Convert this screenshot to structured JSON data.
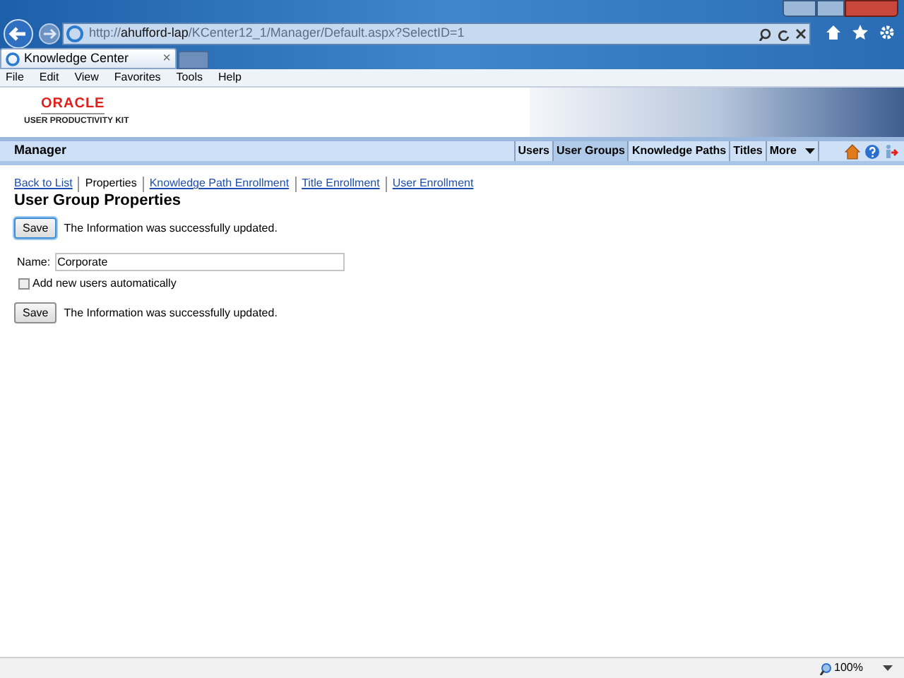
{
  "browser": {
    "url": "http://**ahufford-lap**/KCenter12_1/Manager/Default.aspx?SelectID=1",
    "tab": {
      "title": "Knowledge Center",
      "close": "×"
    },
    "menu": [
      "File",
      "Edit",
      "View",
      "Favorites",
      "Tools",
      "Help"
    ],
    "zoom": "100%"
  },
  "header": {
    "brand": "ORACLE",
    "product": "USER PRODUCTIVITY KIT"
  },
  "nav": {
    "title": "Manager",
    "items": [
      {
        "label": "Users",
        "selected": false
      },
      {
        "label": "User Groups",
        "selected": true
      },
      {
        "label": "Knowledge Paths",
        "selected": false
      },
      {
        "label": "Titles",
        "selected": false
      },
      {
        "label": "More",
        "selected": false
      }
    ]
  },
  "subnav": [
    {
      "label": "Back to List",
      "selected": false
    },
    {
      "label": "Properties",
      "selected": true
    },
    {
      "label": "Knowledge Path Enrollment",
      "selected": false
    },
    {
      "label": "Title Enrollment",
      "selected": false
    },
    {
      "label": "User Enrollment",
      "selected": false
    }
  ],
  "heading": "User Group Properties",
  "save_top": {
    "button": "Save",
    "focused": true,
    "message": "The Information was successfully updated."
  },
  "name_field": {
    "label": "Name:",
    "value": "Corporate"
  },
  "auto_add": {
    "label": "Add new users automatically",
    "checked": false
  },
  "save_bottom": {
    "button": "Save",
    "focused": false,
    "message": "The Information was successfully updated."
  }
}
